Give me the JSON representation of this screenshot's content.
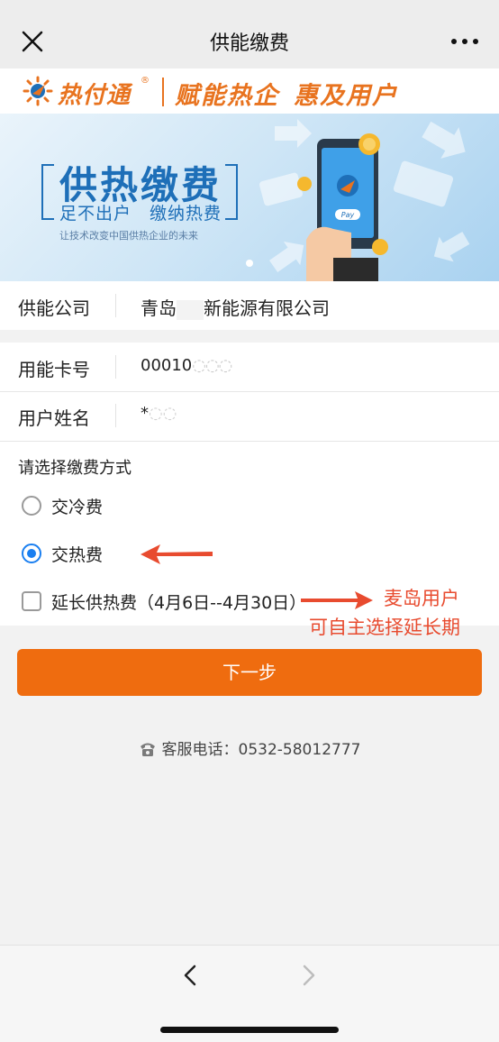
{
  "navbar": {
    "title": "供能缴费"
  },
  "logo_strip": {
    "logo_text": "热付通",
    "logo_mark": "®",
    "slogan_1": "赋能热企",
    "slogan_2": "惠及用户"
  },
  "banner": {
    "title": "供热缴费",
    "subtitle": "足不出户　缴纳热费",
    "tagline": "让技术改变中国供热企业的未来",
    "pay_label": "Pay"
  },
  "form": {
    "company_label": "供能公司",
    "company_value_prefix": "青岛",
    "company_value_suffix": "新能源有限公司",
    "card_label": "用能卡号",
    "card_value": "00010",
    "name_label": "用户姓名",
    "name_value": "*"
  },
  "payment": {
    "title": "请选择缴费方式",
    "options": [
      {
        "label": "交冷费",
        "type": "radio",
        "checked": false
      },
      {
        "label": "交热费",
        "type": "radio",
        "checked": true
      },
      {
        "label": "延长供热费（4月6日--4月30日）",
        "type": "checkbox",
        "checked": false
      }
    ],
    "annotation_line1": "麦岛用户",
    "annotation_line2": "可自主选择延长期"
  },
  "next_button": "下一步",
  "service": {
    "label": "客服电话：0532-58012777"
  },
  "colors": {
    "accent": "#ef6c0f",
    "radio_blue": "#1a7ff0",
    "annotation_red": "#e84b2f",
    "banner_blue": "#1e6fb8"
  }
}
